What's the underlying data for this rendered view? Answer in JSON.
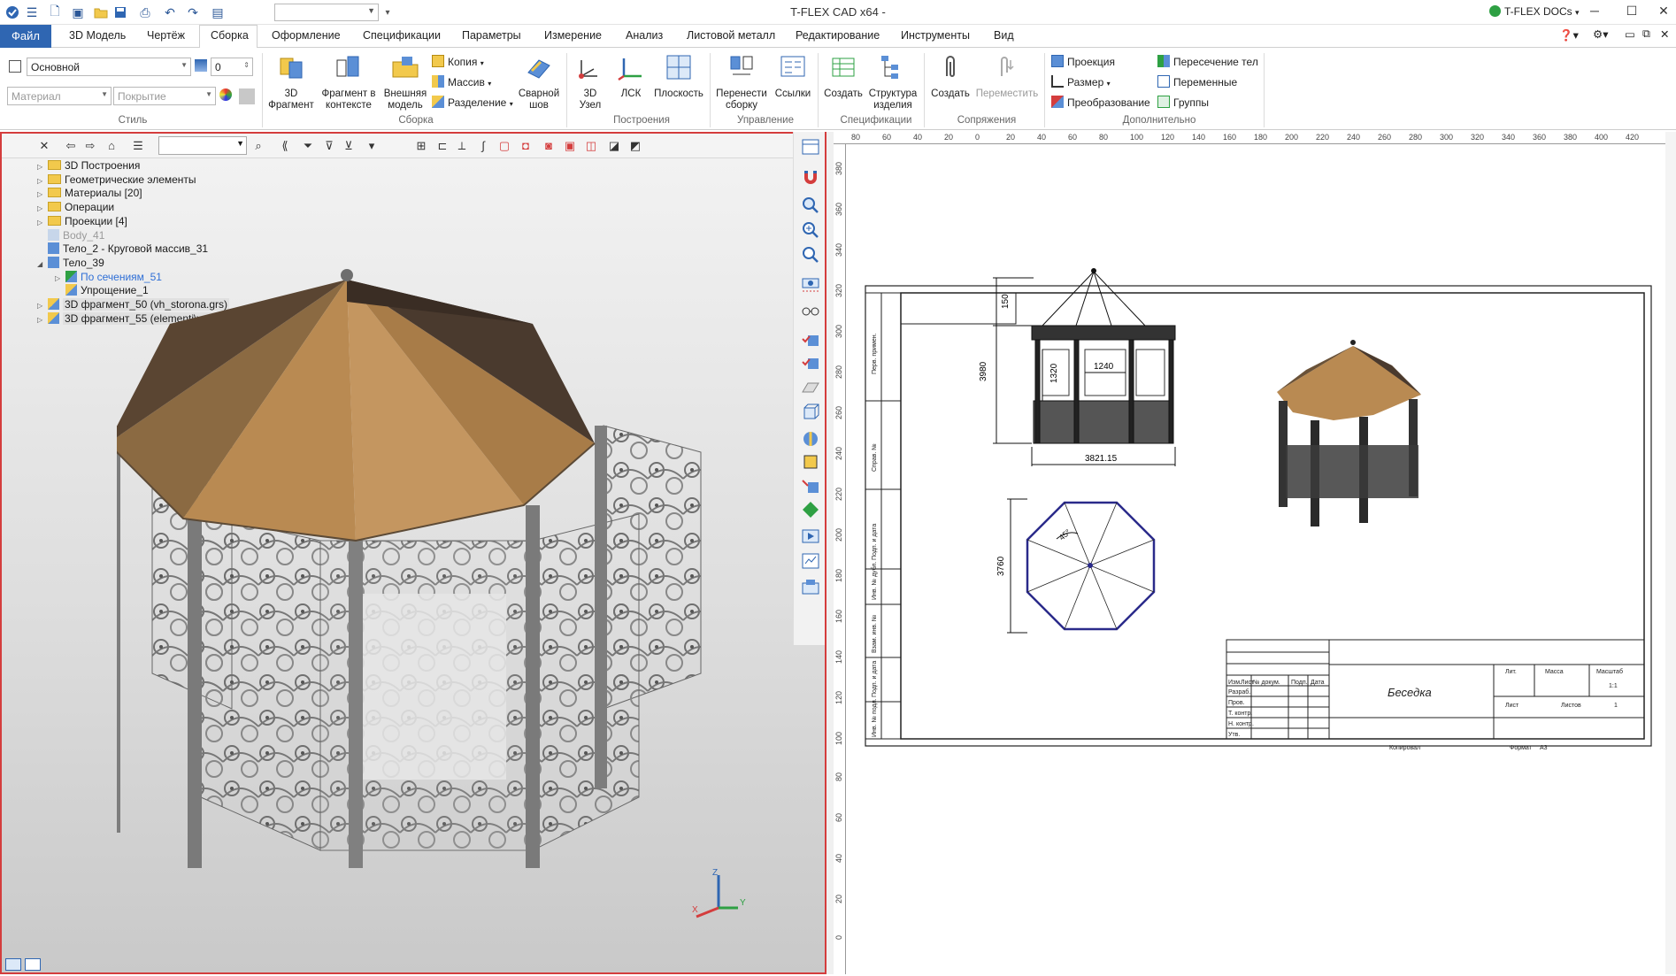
{
  "app": {
    "title": "T-FLEX CAD x64 -",
    "docs_label": "T-FLEX DOCs"
  },
  "tabs": [
    "Файл",
    "3D Модель",
    "Чертёж",
    "Сборка",
    "Оформление",
    "Спецификации",
    "Параметры",
    "Измерение",
    "Анализ",
    "Листовой металл",
    "Редактирование",
    "Инструменты",
    "Вид"
  ],
  "ribbon": {
    "style": {
      "layer": "Основной",
      "layer_num": "0",
      "material": "Материал",
      "coating": "Покрытие",
      "label": "Стиль"
    },
    "assembly": {
      "label": "Сборка",
      "btn_3d_fragment": "3D\nФрагмент",
      "btn_fragment_context": "Фрагмент в\nконтексте",
      "btn_external_model": "Внешняя\nмодель",
      "copy": "Копия",
      "massiv": "Массив",
      "split": "Разделение",
      "weld": "Сварной\nшов"
    },
    "constructions": {
      "label": "Построения",
      "node3d": "3D\nУзел",
      "lsk": "ЛСК",
      "plane": "Плоскость"
    },
    "management": {
      "label": "Управление",
      "move_assembly": "Перенести\nсборку",
      "links": "Ссылки"
    },
    "specs": {
      "label": "Спецификации",
      "create": "Создать",
      "structure": "Структура\nизделия"
    },
    "mates": {
      "label": "Сопряжения",
      "create": "Создать",
      "move": "Переместить"
    },
    "extra": {
      "label": "Дополнительно",
      "projection": "Проекция",
      "size": "Размер",
      "transform": "Преобразование",
      "intersection": "Пересечение тел",
      "variables": "Переменные",
      "groups": "Группы"
    }
  },
  "tree": [
    {
      "label": "3D Построения",
      "type": "folder",
      "expand": "▷",
      "level": 0
    },
    {
      "label": "Геометрические элементы",
      "type": "folder",
      "expand": "▷",
      "level": 0
    },
    {
      "label": "Материалы [20]",
      "type": "folder",
      "expand": "▷",
      "level": 0
    },
    {
      "label": "Операции",
      "type": "folder",
      "expand": "▷",
      "level": 0
    },
    {
      "label": "Проекции [4]",
      "type": "folder",
      "expand": "▷",
      "level": 0
    },
    {
      "label": "Body_41",
      "type": "body-grey",
      "expand": "",
      "level": 0
    },
    {
      "label": "Тело_2 - Круговой массив_31",
      "type": "body",
      "expand": "",
      "level": 0
    },
    {
      "label": "Тело_39",
      "type": "body",
      "expand": "◢",
      "level": 0
    },
    {
      "label": "По сечениям_51",
      "type": "op",
      "expand": "▷",
      "level": 1
    },
    {
      "label": "Упрощение_1",
      "type": "op2",
      "expand": "",
      "level": 1
    },
    {
      "label": "3D фрагмент_50 (vh_storona.grs)",
      "type": "frag",
      "expand": "▷",
      "level": 0
    },
    {
      "label": "3D фрагмент_55 (elementi\\verh.grs)",
      "type": "frag",
      "expand": "▷",
      "level": 0
    }
  ],
  "drawing": {
    "dims": {
      "top_h": "150",
      "height": "3980",
      "opening_h": "1320",
      "opening_w": "1240",
      "width": "3821.15",
      "plan": "3760",
      "angle": "45°"
    },
    "title_block": {
      "name": "Беседка",
      "lit": "Лит.",
      "mass": "Масса",
      "scale": "Масштаб",
      "scale_val": "1:1",
      "sheet": "Лист",
      "sheets": "Листов",
      "sheets_val": "1",
      "copied": "Копировал",
      "format": "Формат",
      "format_val": "А3",
      "rows": [
        "Изм.",
        "Лист",
        "№ докум.",
        "Подп.",
        "Дата",
        "Разраб.",
        "Пров.",
        "Т. контр.",
        "Н. контр.",
        "Утв."
      ]
    },
    "side_labels": [
      "Перв. примен.",
      "Справ. №",
      "Подп. и дата",
      "Инв. № дубл.",
      "Взам. инв. №",
      "Подп. и дата",
      "Инв. № подл."
    ]
  },
  "ruler_h": [
    "80",
    "60",
    "40",
    "20",
    "0",
    "20",
    "40",
    "60",
    "80",
    "100",
    "120",
    "140",
    "160",
    "180",
    "200",
    "220",
    "240",
    "260",
    "280",
    "300",
    "320",
    "340",
    "360",
    "380",
    "400",
    "420"
  ],
  "ruler_v": [
    "380",
    "360",
    "340",
    "320",
    "300",
    "280",
    "260",
    "240",
    "220",
    "200",
    "180",
    "160",
    "140",
    "120",
    "100",
    "80",
    "60",
    "40",
    "20",
    "0"
  ],
  "axes": {
    "x": "X",
    "y": "Y",
    "z": "Z"
  },
  "colors": {
    "accent": "#2f66b2",
    "roof": "#b98a52",
    "roof_dark": "#4a3a2e",
    "metal": "#8f8f8f",
    "selection": "#d43d3d"
  }
}
